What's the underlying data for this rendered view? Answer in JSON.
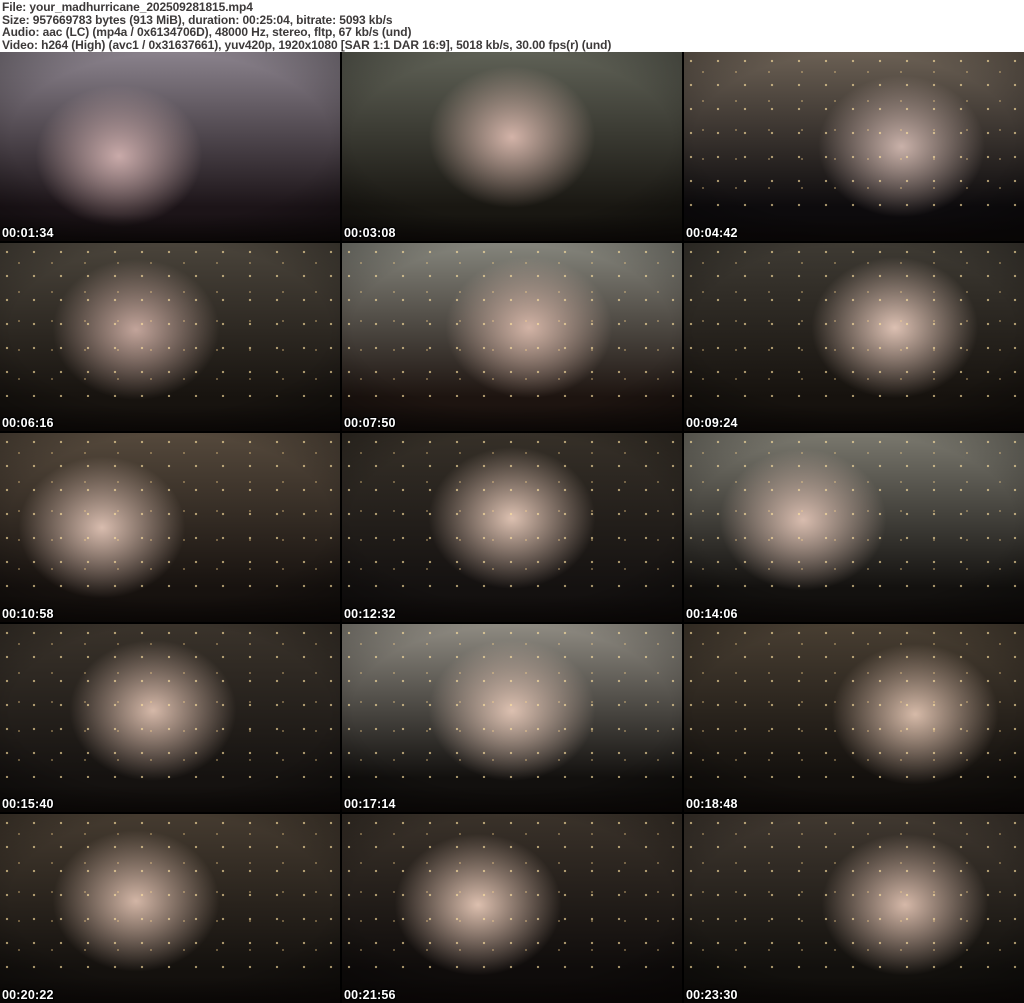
{
  "header": {
    "background": "#ffffff",
    "text_color": "#3d3a3a",
    "file_line": "File: your_madhurricane_202509281815.mp4",
    "size_line": "Size: 957669783 bytes (913 MiB), duration: 00:25:04, bitrate: 5093 kb/s",
    "audio_line": "Audio: aac (LC) (mp4a / 0x6134706D), 48000 Hz, stereo, fltp, 67 kb/s (und)",
    "video_line": "Video: h264 (High) (avc1 / 0x31637661), yuv420p, 1920x1080 [SAR 1:1 DAR 16:9], 5018 kb/s, 30.00 fps(r) (und)"
  },
  "grid": {
    "columns": 3,
    "rows": 5,
    "separator_color": "#000000",
    "timestamp_text_color": "#ffffff",
    "timestamp_outline_color": "#000000"
  },
  "thumbnails": [
    {
      "time": "00:01:34",
      "wall": "#8a828c",
      "base": "#1c1418",
      "glow": "#c9aaa9",
      "glow_x": "35%",
      "glow_y": "55%",
      "lights": false
    },
    {
      "time": "00:03:08",
      "wall": "#5f6156",
      "base": "#191712",
      "glow": "#d3b3a8",
      "glow_x": "50%",
      "glow_y": "45%",
      "lights": false
    },
    {
      "time": "00:04:42",
      "wall": "#6b6054",
      "base": "#0d0b0d",
      "glow": "#c9b1a9",
      "glow_x": "64%",
      "glow_y": "50%",
      "lights": true
    },
    {
      "time": "00:06:16",
      "wall": "#4a443b",
      "base": "#17130f",
      "glow": "#c2a49a",
      "glow_x": "40%",
      "glow_y": "46%",
      "lights": true
    },
    {
      "time": "00:07:50",
      "wall": "#85857c",
      "base": "#1d1410",
      "glow": "#d2b3a5",
      "glow_x": "55%",
      "glow_y": "45%",
      "lights": true
    },
    {
      "time": "00:09:24",
      "wall": "#3e3a33",
      "base": "#16120e",
      "glow": "#dcc0b2",
      "glow_x": "62%",
      "glow_y": "45%",
      "lights": true
    },
    {
      "time": "00:10:58",
      "wall": "#55493c",
      "base": "#17120f",
      "glow": "#d8bcae",
      "glow_x": "30%",
      "glow_y": "50%",
      "lights": true
    },
    {
      "time": "00:12:32",
      "wall": "#363028",
      "base": "#141110",
      "glow": "#dcc0b0",
      "glow_x": "50%",
      "glow_y": "45%",
      "lights": true
    },
    {
      "time": "00:14:06",
      "wall": "#7a786e",
      "base": "#13110f",
      "glow": "#d8bcae",
      "glow_x": "35%",
      "glow_y": "46%",
      "lights": true
    },
    {
      "time": "00:15:40",
      "wall": "#3a332b",
      "base": "#151210",
      "glow": "#d5b8a8",
      "glow_x": "45%",
      "glow_y": "46%",
      "lights": true
    },
    {
      "time": "00:17:14",
      "wall": "#8f8b82",
      "base": "#12100e",
      "glow": "#dcc0b0",
      "glow_x": "50%",
      "glow_y": "46%",
      "lights": true
    },
    {
      "time": "00:18:48",
      "wall": "#483e32",
      "base": "#13100d",
      "glow": "#d6baa8",
      "glow_x": "68%",
      "glow_y": "48%",
      "lights": true
    },
    {
      "time": "00:20:22",
      "wall": "#453b30",
      "base": "#14110e",
      "glow": "#d2b5a5",
      "glow_x": "40%",
      "glow_y": "46%",
      "lights": true
    },
    {
      "time": "00:21:56",
      "wall": "#3a322a",
      "base": "#0f0c0b",
      "glow": "#dcbfae",
      "glow_x": "40%",
      "glow_y": "48%",
      "lights": true
    },
    {
      "time": "00:23:30",
      "wall": "#403830",
      "base": "#12100d",
      "glow": "#d5b8a8",
      "glow_x": "65%",
      "glow_y": "48%",
      "lights": true
    }
  ]
}
